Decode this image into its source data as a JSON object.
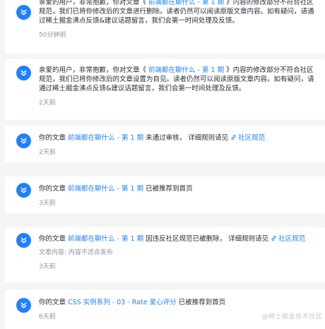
{
  "notifications": [
    {
      "pre": "亲爱的用户，非常抱歉，你对文章《",
      "link": " 前端都在聊什么 - 第 1 期 ",
      "post": "》内容的修改部分不符合社区规范，我们已将你修改后的文章进行删除。读者仍然可以阅读原版文章内容。如有疑问，请通过稀土掘金沸点反馈&建议话题留言，我们会第一时间处理及反馈。",
      "time": "50分钟前"
    },
    {
      "pre": "亲爱的用户，非常抱歉，你对文章《",
      "link": " 前端都在聊什么 - 第 1 期 ",
      "post": "》内容的修改部分不符合社区规范，我们已将你修改后的文章设置为自见。读者仍然可以阅读原版文章内容。如有疑问，请通过稀土掘金沸点反馈&建议话题留言，我们会第一时间处理及反馈。",
      "time": "2天前"
    },
    {
      "pre": "你的文章 ",
      "link": "前端都在聊什么 - 第 1 期",
      "mid": " 未通过审核， 详细规则请见 ",
      "rule_icon": "link-icon",
      "rule_link": "社区规范",
      "time": "2天前"
    },
    {
      "pre": "你的文章 ",
      "link": "前端都在聊什么 - 第 1 期",
      "post": " 已被推荐到首页",
      "time": "3天前"
    },
    {
      "pre": "你的文章 ",
      "link": "前端都在聊什么 - 第 1 期",
      "mid": " 因违反社区规范已被删除， 详细规则请见 ",
      "rule_icon": "link-icon",
      "rule_link": "社区规范",
      "detail": "文章内容: 内容不适合发布",
      "time": "3天前"
    },
    {
      "pre": "你的文章 ",
      "link": "CSS 实例系列 - 03 - Rate 爱心评分",
      "post": " 已被推荐到首页",
      "time": "6天前"
    }
  ],
  "watermark": "@稀土掘金技术社区",
  "colors": {
    "accent": "#1e80ff",
    "text": "#252933",
    "muted": "#8a919f",
    "background": "#f4f5f5"
  }
}
